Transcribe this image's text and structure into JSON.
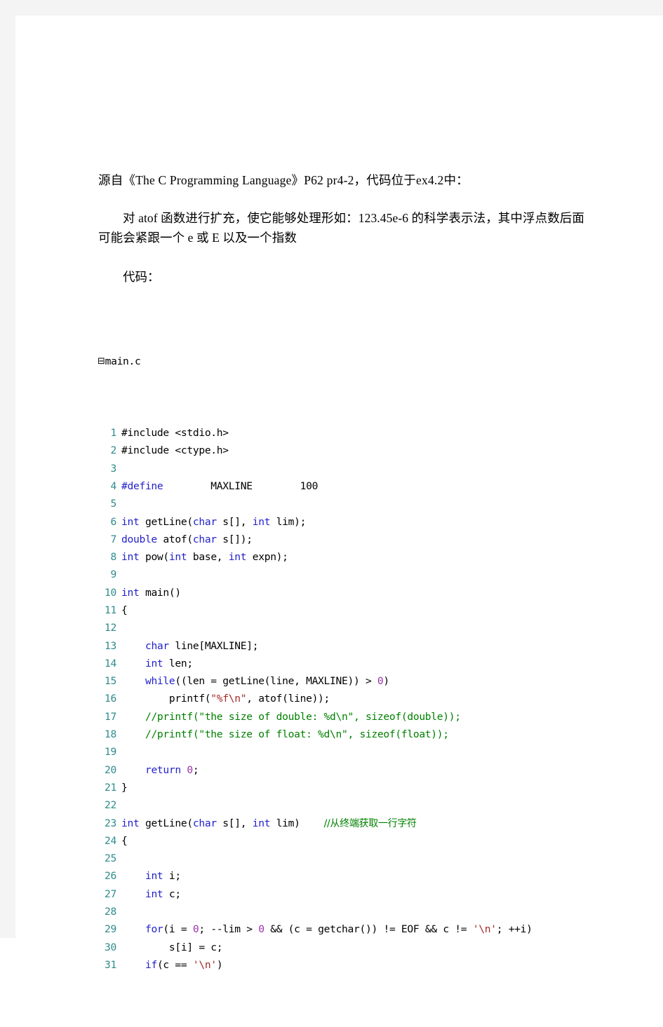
{
  "document": {
    "intro_line": "源自《The C Programming Language》P62 pr4-2，代码位于ex4.2中：",
    "body_paragraph": "对 atof 函数进行扩充，使它能够处理形如：123.45e-6 的科学表示法，其中浮点数后面可能会紧跟一个 e 或 E 以及一个指数",
    "code_label": "代码："
  },
  "code_block": {
    "fold_glyph": "⊟",
    "filename": "main.c",
    "colors": {
      "line_number": "#2e8b8b",
      "keyword": "#2222cc",
      "string": "#a52a2a",
      "number": "#9933aa",
      "comment": "#008000",
      "plain": "#000000"
    },
    "lines": [
      {
        "num": "1",
        "tokens": [
          {
            "t": "#include ",
            "c": "plain"
          },
          {
            "t": "<stdio.h>",
            "c": "plain"
          }
        ]
      },
      {
        "num": "2",
        "tokens": [
          {
            "t": "#include ",
            "c": "plain"
          },
          {
            "t": "<ctype.h>",
            "c": "plain"
          }
        ]
      },
      {
        "num": "3",
        "tokens": []
      },
      {
        "num": "4",
        "tokens": [
          {
            "t": "#define",
            "c": "pre"
          },
          {
            "t": "        MAXLINE        ",
            "c": "plain"
          },
          {
            "t": "100",
            "c": "plain"
          }
        ]
      },
      {
        "num": "5",
        "tokens": []
      },
      {
        "num": "6",
        "tokens": [
          {
            "t": "int",
            "c": "kw"
          },
          {
            "t": " getLine(",
            "c": "plain"
          },
          {
            "t": "char",
            "c": "kw"
          },
          {
            "t": " s[], ",
            "c": "plain"
          },
          {
            "t": "int",
            "c": "kw"
          },
          {
            "t": " lim);",
            "c": "plain"
          }
        ]
      },
      {
        "num": "7",
        "tokens": [
          {
            "t": "double",
            "c": "kw"
          },
          {
            "t": " atof(",
            "c": "plain"
          },
          {
            "t": "char",
            "c": "kw"
          },
          {
            "t": " s[]);",
            "c": "plain"
          }
        ]
      },
      {
        "num": "8",
        "tokens": [
          {
            "t": "int",
            "c": "kw"
          },
          {
            "t": " pow(",
            "c": "plain"
          },
          {
            "t": "int",
            "c": "kw"
          },
          {
            "t": " base, ",
            "c": "plain"
          },
          {
            "t": "int",
            "c": "kw"
          },
          {
            "t": " expn);",
            "c": "plain"
          }
        ]
      },
      {
        "num": "9",
        "tokens": []
      },
      {
        "num": "10",
        "tokens": [
          {
            "t": "int",
            "c": "kw"
          },
          {
            "t": " main()",
            "c": "plain"
          }
        ]
      },
      {
        "num": "11",
        "tokens": [
          {
            "t": "{",
            "c": "plain"
          }
        ]
      },
      {
        "num": "12",
        "tokens": []
      },
      {
        "num": "13",
        "tokens": [
          {
            "t": "    ",
            "c": "plain"
          },
          {
            "t": "char",
            "c": "kw"
          },
          {
            "t": " line[MAXLINE];",
            "c": "plain"
          }
        ]
      },
      {
        "num": "14",
        "tokens": [
          {
            "t": "    ",
            "c": "plain"
          },
          {
            "t": "int",
            "c": "kw"
          },
          {
            "t": " len;",
            "c": "plain"
          }
        ]
      },
      {
        "num": "15",
        "tokens": [
          {
            "t": "    ",
            "c": "plain"
          },
          {
            "t": "while",
            "c": "kw"
          },
          {
            "t": "((len = getLine(line, MAXLINE)) > ",
            "c": "plain"
          },
          {
            "t": "0",
            "c": "num"
          },
          {
            "t": ")",
            "c": "plain"
          }
        ]
      },
      {
        "num": "16",
        "tokens": [
          {
            "t": "        printf(",
            "c": "plain"
          },
          {
            "t": "\"%f\\n\"",
            "c": "str"
          },
          {
            "t": ", atof(line));",
            "c": "plain"
          }
        ]
      },
      {
        "num": "17",
        "tokens": [
          {
            "t": "    ",
            "c": "plain"
          },
          {
            "t": "//printf(\"the size of double: %d\\n\", sizeof(double));",
            "c": "cmt"
          }
        ]
      },
      {
        "num": "18",
        "tokens": [
          {
            "t": "    ",
            "c": "plain"
          },
          {
            "t": "//printf(\"the size of float: %d\\n\", sizeof(float));",
            "c": "cmt"
          }
        ]
      },
      {
        "num": "19",
        "tokens": []
      },
      {
        "num": "20",
        "tokens": [
          {
            "t": "    ",
            "c": "plain"
          },
          {
            "t": "return",
            "c": "kw"
          },
          {
            "t": " ",
            "c": "plain"
          },
          {
            "t": "0",
            "c": "num"
          },
          {
            "t": ";",
            "c": "plain"
          }
        ]
      },
      {
        "num": "21",
        "tokens": [
          {
            "t": "}",
            "c": "plain"
          }
        ]
      },
      {
        "num": "22",
        "tokens": []
      },
      {
        "num": "23",
        "tokens": [
          {
            "t": "int",
            "c": "kw"
          },
          {
            "t": " getLine(",
            "c": "plain"
          },
          {
            "t": "char",
            "c": "kw"
          },
          {
            "t": " s[], ",
            "c": "plain"
          },
          {
            "t": "int",
            "c": "kw"
          },
          {
            "t": " lim)    ",
            "c": "plain"
          },
          {
            "t": "//从终端获取一行字符",
            "c": "cmt-cjk"
          }
        ]
      },
      {
        "num": "24",
        "tokens": [
          {
            "t": "{",
            "c": "plain"
          }
        ]
      },
      {
        "num": "25",
        "tokens": []
      },
      {
        "num": "26",
        "tokens": [
          {
            "t": "    ",
            "c": "plain"
          },
          {
            "t": "int",
            "c": "kw"
          },
          {
            "t": " i;",
            "c": "plain"
          }
        ]
      },
      {
        "num": "27",
        "tokens": [
          {
            "t": "    ",
            "c": "plain"
          },
          {
            "t": "int",
            "c": "kw"
          },
          {
            "t": " c;",
            "c": "plain"
          }
        ]
      },
      {
        "num": "28",
        "tokens": []
      },
      {
        "num": "29",
        "tokens": [
          {
            "t": "    ",
            "c": "plain"
          },
          {
            "t": "for",
            "c": "kw"
          },
          {
            "t": "(i = ",
            "c": "plain"
          },
          {
            "t": "0",
            "c": "num"
          },
          {
            "t": "; --lim > ",
            "c": "plain"
          },
          {
            "t": "0",
            "c": "num"
          },
          {
            "t": " && (c = getchar()) != EOF && c != ",
            "c": "plain"
          },
          {
            "t": "'\\n'",
            "c": "str"
          },
          {
            "t": "; ++i)",
            "c": "plain"
          }
        ]
      },
      {
        "num": "30",
        "tokens": [
          {
            "t": "        s[i] = c;",
            "c": "plain"
          }
        ]
      },
      {
        "num": "31",
        "tokens": [
          {
            "t": "    ",
            "c": "plain"
          },
          {
            "t": "if",
            "c": "kw"
          },
          {
            "t": "(c == ",
            "c": "plain"
          },
          {
            "t": "'\\n'",
            "c": "str"
          },
          {
            "t": ")",
            "c": "plain"
          }
        ]
      }
    ]
  }
}
